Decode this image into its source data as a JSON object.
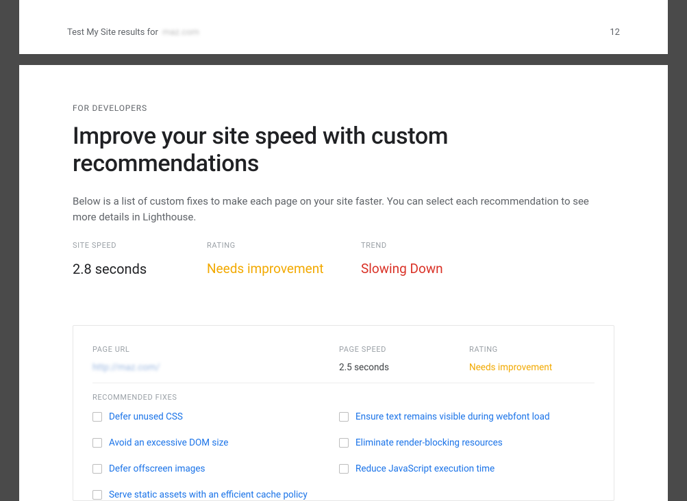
{
  "topbar": {
    "prefix": "Test My Site results for",
    "site": "maz.com",
    "page_number": "12"
  },
  "eyebrow": "FOR DEVELOPERS",
  "title": "Improve your site speed with custom recommendations",
  "description": "Below is a list of custom fixes to make each page on your site faster. You can select each recommendation to see more details in Lighthouse.",
  "metrics": {
    "site_speed": {
      "label": "SITE SPEED",
      "value": "2.8 seconds"
    },
    "rating": {
      "label": "RATING",
      "value": "Needs improvement"
    },
    "trend": {
      "label": "TREND",
      "value": "Slowing Down"
    }
  },
  "panel": {
    "headers": {
      "url": "PAGE URL",
      "speed": "PAGE SPEED",
      "rating": "RATING"
    },
    "row": {
      "url": "http://maz.com/",
      "speed": "2.5 seconds",
      "rating": "Needs improvement"
    },
    "fixes_label": "RECOMMENDED FIXES",
    "fixes": [
      "Defer unused CSS",
      "Ensure text remains visible during webfont load",
      "Avoid an excessive DOM size",
      "Eliminate render-blocking resources",
      "Defer offscreen images",
      "Reduce JavaScript execution time",
      "Serve static assets with an efficient cache policy"
    ]
  }
}
